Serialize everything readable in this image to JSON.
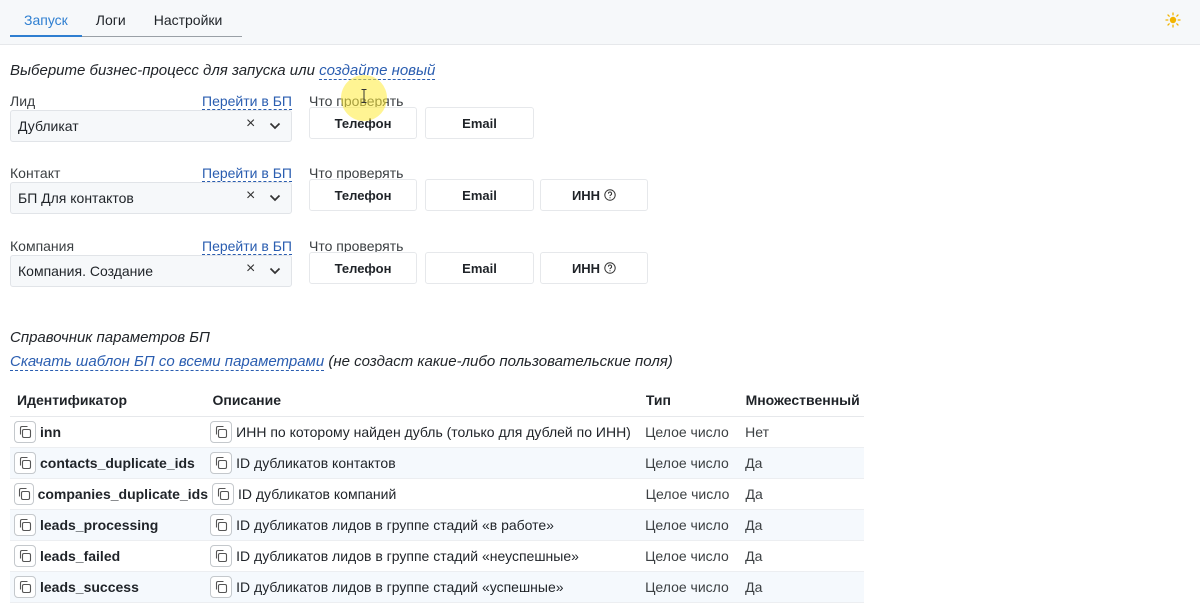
{
  "tabs": [
    {
      "label": "Запуск",
      "active": true
    },
    {
      "label": "Логи",
      "active": false
    },
    {
      "label": "Настройки",
      "active": false
    }
  ],
  "theme_icon": "sun-icon",
  "intro": {
    "text": "Выберите бизнес-процесс для запуска или ",
    "link": "создайте новый"
  },
  "processes": [
    {
      "entity": "Лид",
      "goto": "Перейти в БП",
      "check_label": "Что проверять",
      "selected": "Дубликат",
      "clear": "×",
      "options": [
        "Телефон",
        "Email"
      ]
    },
    {
      "entity": "Контакт",
      "goto": "Перейти в БП",
      "check_label": "Что проверять",
      "selected": "БП Для контактов",
      "clear": "×",
      "options": [
        "Телефон",
        "Email",
        "ИНН"
      ]
    },
    {
      "entity": "Компания",
      "goto": "Перейти в БП",
      "check_label": "Что проверять",
      "selected": "Компания. Создание",
      "clear": "×",
      "options": [
        "Телефон",
        "Email",
        "ИНН"
      ]
    }
  ],
  "reference": {
    "title": "Справочник параметров БП",
    "download_link": "Скачать шаблон БП со всеми параметрами",
    "download_note": " (не создаст какие-либо пользовательские поля)"
  },
  "table": {
    "headers": [
      "Идентификатор",
      "Описание",
      "Тип",
      "Множественный"
    ],
    "rows": [
      {
        "id": "inn",
        "desc": "ИНН по которому найден дубль (только для дублей по ИНН)",
        "type": "Целое число",
        "multiple": "Нет"
      },
      {
        "id": "contacts_duplicate_ids",
        "desc": "ID дубликатов контактов",
        "type": "Целое число",
        "multiple": "Да"
      },
      {
        "id": "companies_duplicate_ids",
        "desc": "ID дубликатов компаний",
        "type": "Целое число",
        "multiple": "Да"
      },
      {
        "id": "leads_processing",
        "desc": "ID дубликатов лидов в группе стадий «в работе»",
        "type": "Целое число",
        "multiple": "Да"
      },
      {
        "id": "leads_failed",
        "desc": "ID дубликатов лидов в группе стадий «неуспешные»",
        "type": "Целое число",
        "multiple": "Да"
      },
      {
        "id": "leads_success",
        "desc": "ID дубликатов лидов в группе стадий «успешные»",
        "type": "Целое число",
        "multiple": "Да"
      }
    ]
  },
  "colors": {
    "accent": "#2f7fd1",
    "link": "#2a5db0",
    "row_alt": "#f5f9fd"
  }
}
